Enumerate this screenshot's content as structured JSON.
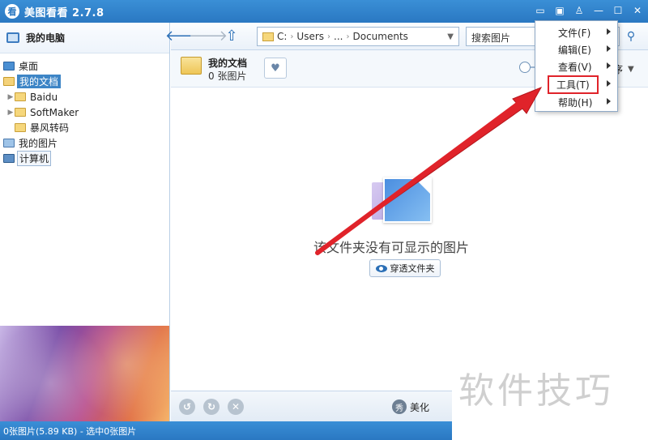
{
  "window": {
    "logo_glyph": "看",
    "title": "美图看看 2.7.8"
  },
  "sidebar": {
    "header": "我的电脑",
    "items": [
      {
        "label": "桌面"
      },
      {
        "label": "我的文档"
      },
      {
        "label": "Baidu"
      },
      {
        "label": "SoftMaker"
      },
      {
        "label": "暴风转码"
      },
      {
        "label": "我的图片"
      },
      {
        "label": "计算机"
      }
    ]
  },
  "toolbar": {
    "path_drive": "C:",
    "path_users": "Users",
    "path_ellipsis": "...",
    "path_current": "Documents",
    "search_text": "搜索图片"
  },
  "folder": {
    "name": "我的文档",
    "count": "0 张图片",
    "sort_label": "序"
  },
  "main": {
    "empty_message": "该文件夹没有可显示的图片",
    "explore_button": "穿透文件夹"
  },
  "bottom": {
    "beautify_glyph": "秀",
    "beautify_label": "美化"
  },
  "status": {
    "text": "0张图片(5.89 KB) - 选中0张图片"
  },
  "menu": {
    "items": [
      {
        "label": "文件(F)"
      },
      {
        "label": "编辑(E)"
      },
      {
        "label": "查看(V)"
      },
      {
        "label": "工具(T)"
      },
      {
        "label": "帮助(H)"
      }
    ]
  },
  "watermark": "软件技巧",
  "colors": {
    "titlebar": "#2a78c2",
    "highlight_box": "#e0232a",
    "selection": "#3d85c6"
  }
}
